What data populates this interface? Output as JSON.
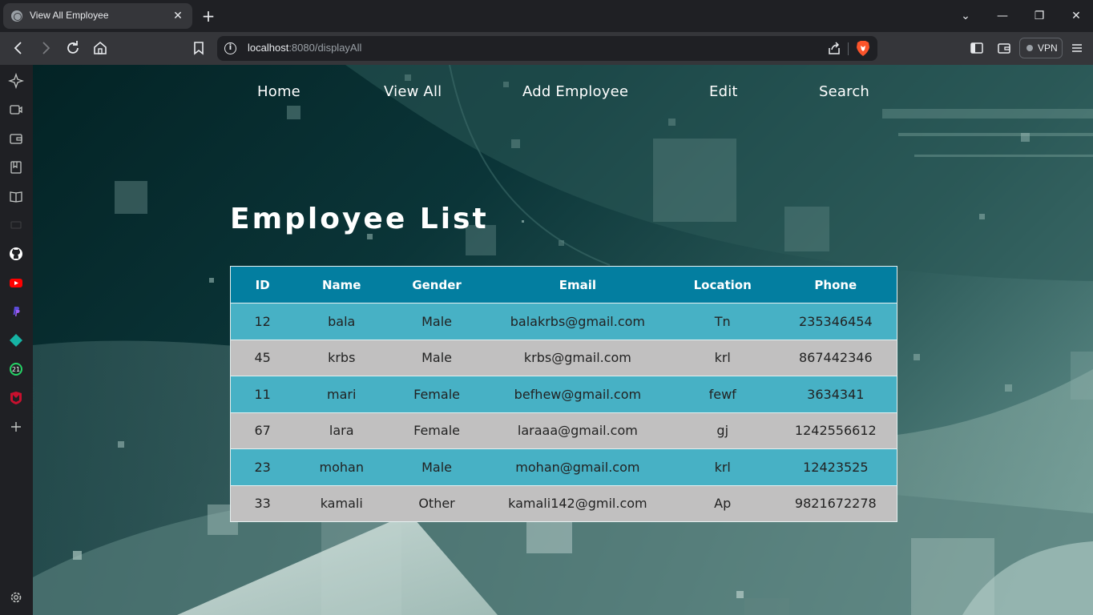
{
  "browser": {
    "tab_title": "View All Employee",
    "url_host": "localhost",
    "url_rest": ":8080/displayAll",
    "vpn_label": "VPN"
  },
  "sidebar": {
    "icons": [
      "leo-ai-icon",
      "video-icon",
      "wallet-icon",
      "bookmarks-icon",
      "reading-list-icon",
      "history-icon",
      "github-icon",
      "youtube-icon",
      "paypal-icon",
      "diamond-app-icon",
      "whatsapp-icon",
      "mcafee-icon",
      "add-icon",
      "settings-icon"
    ],
    "whatsapp_badge": "21"
  },
  "nav": {
    "home": "Home",
    "view_all": "View All",
    "add_employee": "Add Employee",
    "edit": "Edit",
    "search": "Search"
  },
  "page": {
    "title": "Employee List"
  },
  "table": {
    "headers": [
      "ID",
      "Name",
      "Gender",
      "Email",
      "Location",
      "Phone"
    ],
    "rows": [
      [
        "12",
        "bala",
        "Male",
        "balakrbs@gmail.com",
        "Tn",
        "235346454"
      ],
      [
        "45",
        "krbs",
        "Male",
        "krbs@gmail.com",
        "krl",
        "867442346"
      ],
      [
        "11",
        "mari",
        "Female",
        "befhew@gmail.com",
        "fewf",
        "3634341"
      ],
      [
        "67",
        "lara",
        "Female",
        "laraaa@gmail.com",
        "gj",
        "1242556612"
      ],
      [
        "23",
        "mohan",
        "Male",
        "mohan@gmail.com",
        "krl",
        "12423525"
      ],
      [
        "33",
        "kamali",
        "Other",
        "kamali142@gmil.com",
        "Ap",
        "9821672278"
      ]
    ]
  },
  "colors": {
    "header_bg": "#037ea0",
    "row_odd_bg": "#47b1c5",
    "row_even_bg": "#c1c0c0"
  }
}
